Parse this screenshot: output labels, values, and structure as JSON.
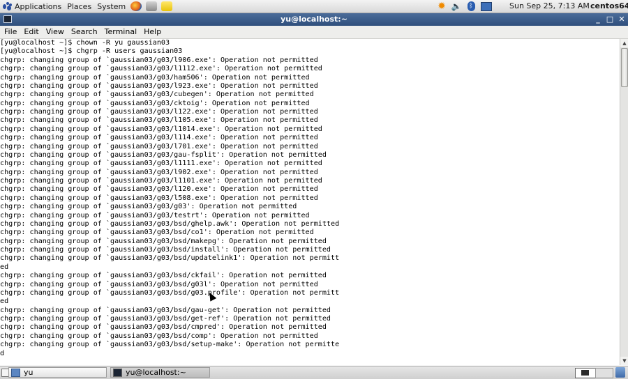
{
  "top_panel": {
    "menus": [
      "Applications",
      "Places",
      "System"
    ],
    "launchers": [
      "firefox-icon",
      "mail-icon",
      "notes-icon"
    ],
    "tray_icons": [
      "update-sun-icon",
      "volume-icon",
      "bluetooth-icon",
      "network-icon"
    ],
    "clock": "Sun Sep 25,  7:13 AM",
    "hostname": "centos64"
  },
  "window": {
    "title": "yu@localhost:~",
    "menu": [
      "File",
      "Edit",
      "View",
      "Search",
      "Terminal",
      "Help"
    ]
  },
  "terminal": {
    "lines": [
      "[yu@localhost ~]$ chown -R yu gaussian03",
      "[yu@localhost ~]$ chgrp -R users gaussian03",
      "chgrp: changing group of `gaussian03/g03/l906.exe': Operation not permitted",
      "chgrp: changing group of `gaussian03/g03/l1112.exe': Operation not permitted",
      "chgrp: changing group of `gaussian03/g03/ham506': Operation not permitted",
      "chgrp: changing group of `gaussian03/g03/l923.exe': Operation not permitted",
      "chgrp: changing group of `gaussian03/g03/cubegen': Operation not permitted",
      "chgrp: changing group of `gaussian03/g03/cktoig': Operation not permitted",
      "chgrp: changing group of `gaussian03/g03/l122.exe': Operation not permitted",
      "chgrp: changing group of `gaussian03/g03/l105.exe': Operation not permitted",
      "chgrp: changing group of `gaussian03/g03/l1014.exe': Operation not permitted",
      "chgrp: changing group of `gaussian03/g03/l114.exe': Operation not permitted",
      "chgrp: changing group of `gaussian03/g03/l701.exe': Operation not permitted",
      "chgrp: changing group of `gaussian03/g03/gau-fsplit': Operation not permitted",
      "chgrp: changing group of `gaussian03/g03/l1111.exe': Operation not permitted",
      "chgrp: changing group of `gaussian03/g03/l902.exe': Operation not permitted",
      "chgrp: changing group of `gaussian03/g03/l1101.exe': Operation not permitted",
      "chgrp: changing group of `gaussian03/g03/l120.exe': Operation not permitted",
      "chgrp: changing group of `gaussian03/g03/l508.exe': Operation not permitted",
      "chgrp: changing group of `gaussian03/g03/g03': Operation not permitted",
      "chgrp: changing group of `gaussian03/g03/testrt': Operation not permitted",
      "chgrp: changing group of `gaussian03/g03/bsd/ghelp.awk': Operation not permitted",
      "chgrp: changing group of `gaussian03/g03/bsd/co1': Operation not permitted",
      "chgrp: changing group of `gaussian03/g03/bsd/makepg': Operation not permitted",
      "chgrp: changing group of `gaussian03/g03/bsd/install': Operation not permitted",
      "chgrp: changing group of `gaussian03/g03/bsd/updatelink1': Operation not permitt",
      "ed",
      "chgrp: changing group of `gaussian03/g03/bsd/ckfail': Operation not permitted",
      "chgrp: changing group of `gaussian03/g03/bsd/g03l': Operation not permitted",
      "chgrp: changing group of `gaussian03/g03/bsd/g03.profile': Operation not permitt",
      "ed",
      "chgrp: changing group of `gaussian03/g03/bsd/gau-get': Operation not permitted",
      "chgrp: changing group of `gaussian03/g03/bsd/get-ref': Operation not permitted",
      "chgrp: changing group of `gaussian03/g03/bsd/cmpred': Operation not permitted",
      "chgrp: changing group of `gaussian03/g03/bsd/comp': Operation not permitted",
      "chgrp: changing group of `gaussian03/g03/bsd/setup-make': Operation not permitte",
      "d"
    ]
  },
  "taskbar": {
    "items": [
      "yu",
      "yu@localhost:~"
    ]
  }
}
